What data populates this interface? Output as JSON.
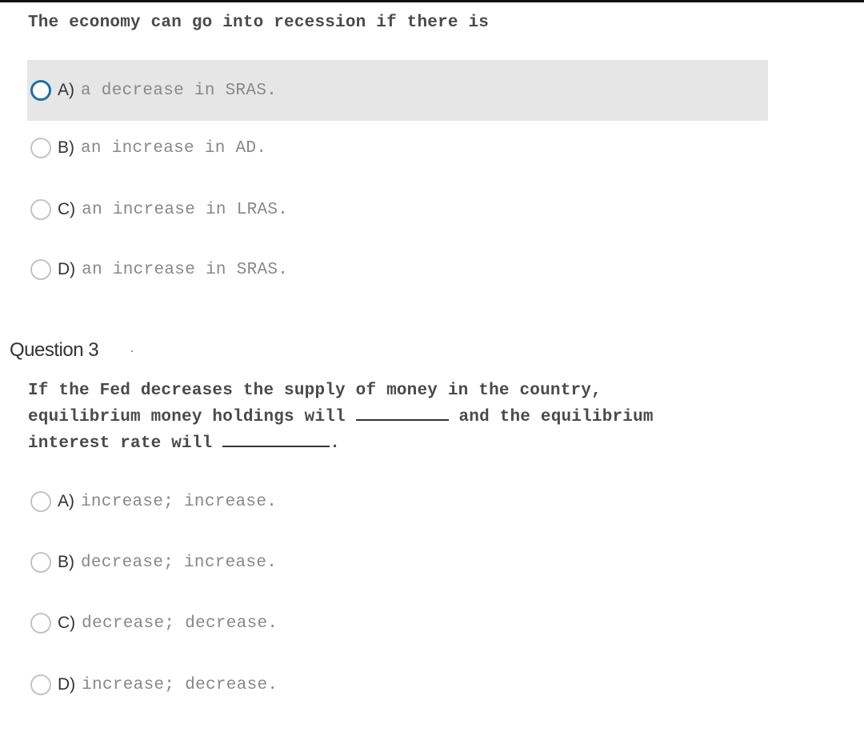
{
  "question_1": {
    "prompt": "The economy can go into recession if there is",
    "options": [
      {
        "letter": "A)",
        "text": "a decrease in SRAS.",
        "highlighted": true
      },
      {
        "letter": "B)",
        "text": "an increase in AD."
      },
      {
        "letter": "C)",
        "text": "an increase in LRAS."
      },
      {
        "letter": "D)",
        "text": "an increase in SRAS."
      }
    ]
  },
  "question_3": {
    "heading": "Question 3",
    "prompt_line1": "If the Fed decreases the supply of money in the country,",
    "prompt_line2a": "equilibrium money holdings will ",
    "prompt_line2b": " and the equilibrium",
    "prompt_line3a": "interest rate will ",
    "prompt_line3b": ".",
    "options": [
      {
        "letter": "A)",
        "text": "increase; increase."
      },
      {
        "letter": "B)",
        "text": "decrease; increase."
      },
      {
        "letter": "C)",
        "text": "decrease; decrease."
      },
      {
        "letter": "D)",
        "text": "increase; decrease."
      }
    ]
  },
  "colors": {
    "highlight": "#e6e6e6",
    "focus_ring": "#1e6fa8"
  }
}
